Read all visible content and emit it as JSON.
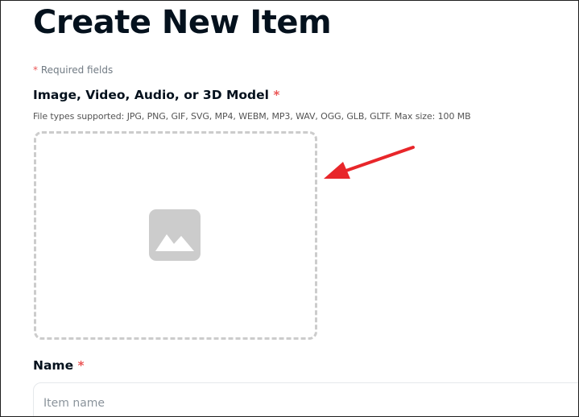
{
  "page": {
    "title": "Create New Item",
    "required_note_asterisk": "*",
    "required_note_text": "Required fields"
  },
  "media_field": {
    "label": "Image, Video, Audio, or 3D Model",
    "required_marker": "*",
    "file_types": "File types supported: JPG, PNG, GIF, SVG, MP4, WEBM, MP3, WAV, OGG, GLB, GLTF. Max size: 100 MB",
    "placeholder_icon": "image-icon"
  },
  "annotation": {
    "icon": "arrow-icon",
    "color": "#e8262a"
  },
  "name_field": {
    "label": "Name",
    "required_marker": "*",
    "placeholder": "Item name",
    "value": ""
  },
  "colors": {
    "required_marker": "#eb5757",
    "dropzone_border": "#cccccc",
    "icon_gray": "#cccccc"
  }
}
